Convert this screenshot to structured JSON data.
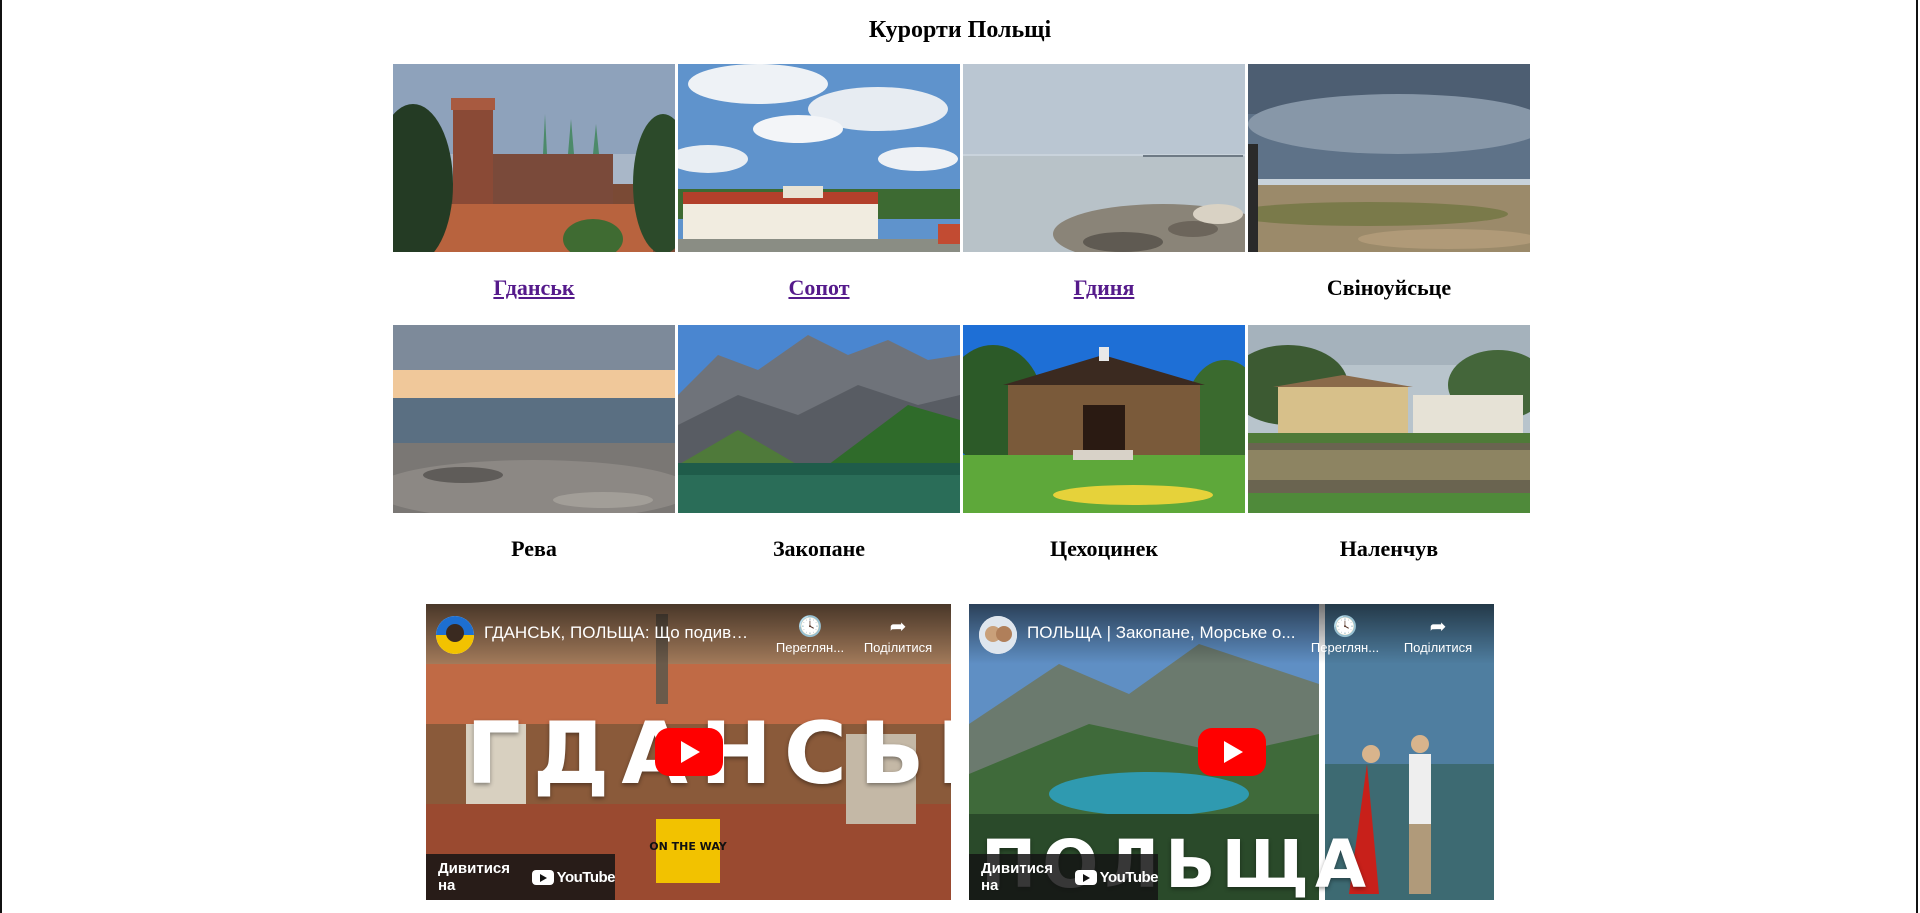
{
  "page": {
    "title": "Курорти Польщі"
  },
  "resorts": [
    {
      "name": "Гданськ",
      "link": true
    },
    {
      "name": "Сопот",
      "link": true
    },
    {
      "name": "Гдиня",
      "link": true
    },
    {
      "name": "Свіноуйсьце",
      "link": false
    },
    {
      "name": "Рева",
      "link": false
    },
    {
      "name": "Закопане",
      "link": false
    },
    {
      "name": "Цехоцинек",
      "link": false
    },
    {
      "name": "Наленчув",
      "link": false
    }
  ],
  "videos": [
    {
      "title": "ГДАНСЬК, ПОЛЬЩА: Що подиви...",
      "watch_later": "Переглян...",
      "share": "Поділитися",
      "watch_on": "Дивитися на",
      "platform": "YouTube",
      "overlay_text": "ГДАНСЬК",
      "badge_text": "ON THE WAY"
    },
    {
      "title": "ПОЛЬЩА | Закопане, Морське о...",
      "watch_later": "Переглян...",
      "share": "Поділитися",
      "watch_on": "Дивитися на",
      "platform": "YouTube",
      "overlay_text": "ПОЛЬЩА"
    }
  ],
  "colors": {
    "visited_link": "#551a8b",
    "youtube_red": "#ff0000"
  }
}
